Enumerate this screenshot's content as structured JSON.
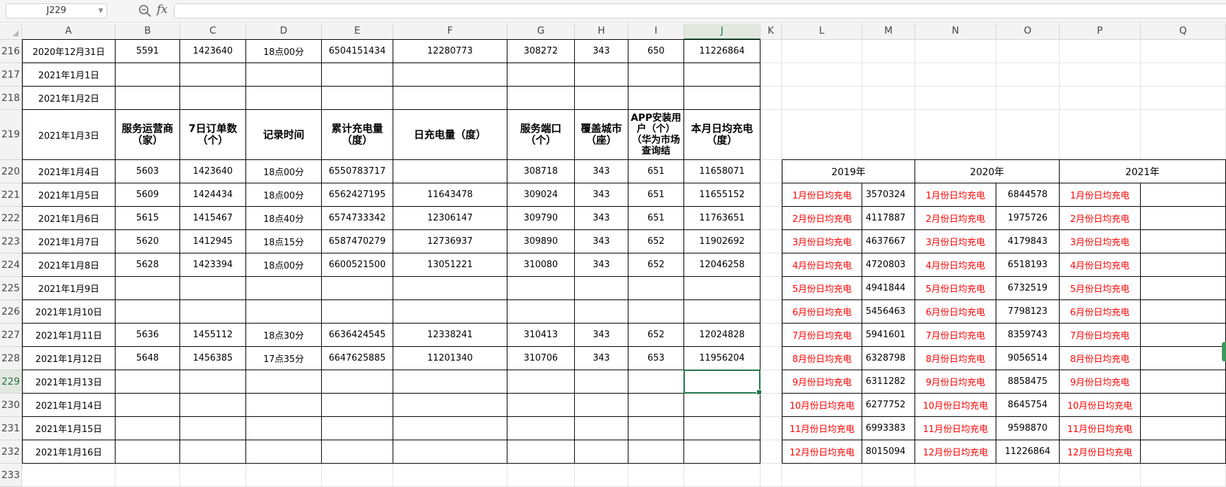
{
  "formula_bar": {
    "name_box": "J229",
    "fx_label": "fx",
    "formula_value": ""
  },
  "columns": [
    {
      "letter": "A",
      "w": 136
    },
    {
      "letter": "B",
      "w": 94
    },
    {
      "letter": "C",
      "w": 96
    },
    {
      "letter": "D",
      "w": 110
    },
    {
      "letter": "E",
      "w": 104
    },
    {
      "letter": "F",
      "w": 166
    },
    {
      "letter": "G",
      "w": 98
    },
    {
      "letter": "H",
      "w": 78
    },
    {
      "letter": "I",
      "w": 81
    },
    {
      "letter": "J",
      "w": 111
    },
    {
      "letter": "K",
      "w": 31
    },
    {
      "letter": "L",
      "w": 117
    },
    {
      "letter": "M",
      "w": 77
    },
    {
      "letter": "N",
      "w": 118
    },
    {
      "letter": "O",
      "w": 92
    },
    {
      "letter": "P",
      "w": 118
    },
    {
      "letter": "Q",
      "w": 124
    }
  ],
  "rows": [
    {
      "num": "216",
      "h": 34
    },
    {
      "num": "217",
      "h": 34
    },
    {
      "num": "218",
      "h": 34
    },
    {
      "num": "219",
      "h": 73
    },
    {
      "num": "220",
      "h": 34
    },
    {
      "num": "221",
      "h": 34
    },
    {
      "num": "222",
      "h": 34
    },
    {
      "num": "223",
      "h": 34
    },
    {
      "num": "224",
      "h": 34
    },
    {
      "num": "225",
      "h": 34
    },
    {
      "num": "226",
      "h": 34
    },
    {
      "num": "227",
      "h": 34
    },
    {
      "num": "228",
      "h": 34
    },
    {
      "num": "229",
      "h": 34
    },
    {
      "num": "230",
      "h": 34
    },
    {
      "num": "231",
      "h": 34
    },
    {
      "num": "232",
      "h": 34
    },
    {
      "num": "233",
      "h": 34
    }
  ],
  "main_headers": [
    "服务运营商（家）",
    "7日订单数（个）",
    "记录时间",
    "累计充电量（度）",
    "日充电量（度）",
    "服务端口（个）",
    "覆盖城市（座）",
    "APP安装用户（个）（华为市场查询结",
    "本月日均充电（度）"
  ],
  "main_table": [
    [
      "2020年12月31日",
      "5591",
      "1423640",
      "18点00分",
      "6504151434",
      "12280773",
      "308272",
      "343",
      "650",
      "11226864"
    ],
    [
      "2021年1月1日",
      "",
      "",
      "",
      "",
      "",
      "",
      "",
      "",
      ""
    ],
    [
      "2021年1月2日",
      "",
      "",
      "",
      "",
      "",
      "",
      "",
      "",
      ""
    ],
    [
      "2021年1月3日"
    ],
    [
      "2021年1月4日",
      "5603",
      "1423640",
      "18点00分",
      "6550783717",
      "",
      "308718",
      "343",
      "651",
      "11658071"
    ],
    [
      "2021年1月5日",
      "5609",
      "1424434",
      "18点00分",
      "6562427195",
      "11643478",
      "309024",
      "343",
      "651",
      "11655152"
    ],
    [
      "2021年1月6日",
      "5615",
      "1415467",
      "18点40分",
      "6574733342",
      "12306147",
      "309790",
      "343",
      "651",
      "11763651"
    ],
    [
      "2021年1月7日",
      "5620",
      "1412945",
      "18点15分",
      "6587470279",
      "12736937",
      "309890",
      "343",
      "652",
      "11902692"
    ],
    [
      "2021年1月8日",
      "5628",
      "1423394",
      "18点00分",
      "6600521500",
      "13051221",
      "310080",
      "343",
      "652",
      "12046258"
    ],
    [
      "2021年1月9日",
      "",
      "",
      "",
      "",
      "",
      "",
      "",
      "",
      ""
    ],
    [
      "2021年1月10日",
      "",
      "",
      "",
      "",
      "",
      "",
      "",
      "",
      ""
    ],
    [
      "2021年1月11日",
      "5636",
      "1455112",
      "18点30分",
      "6636424545",
      "12338241",
      "310413",
      "343",
      "652",
      "12024828"
    ],
    [
      "2021年1月12日",
      "5648",
      "1456385",
      "17点35分",
      "6647625885",
      "11201340",
      "310706",
      "343",
      "653",
      "11956204"
    ],
    [
      "2021年1月13日",
      "",
      "",
      "",
      "",
      "",
      "",
      "",
      "",
      ""
    ],
    [
      "2021年1月14日",
      "",
      "",
      "",
      "",
      "",
      "",
      "",
      "",
      ""
    ],
    [
      "2021年1月15日",
      "",
      "",
      "",
      "",
      "",
      "",
      "",
      "",
      ""
    ],
    [
      "2021年1月16日",
      "",
      "",
      "",
      "",
      "",
      "",
      "",
      "",
      ""
    ]
  ],
  "side_table": {
    "years": [
      "2019年",
      "2020年",
      "2021年"
    ],
    "rows": [
      [
        "1月份日均充电",
        "3570324",
        "1月份日均充电",
        "6844578",
        "1月份日均充电"
      ],
      [
        "2月份日均充电",
        "4117887",
        "2月份日均充电",
        "1975726",
        "2月份日均充电"
      ],
      [
        "3月份日均充电",
        "4637667",
        "3月份日均充电",
        "4179843",
        "3月份日均充电"
      ],
      [
        "4月份日均充电",
        "4720803",
        "4月份日均充电",
        "6518193",
        "4月份日均充电"
      ],
      [
        "5月份日均充电",
        "4941844",
        "5月份日均充电",
        "6732519",
        "5月份日均充电"
      ],
      [
        "6月份日均充电",
        "5456463",
        "6月份日均充电",
        "7798123",
        "6月份日均充电"
      ],
      [
        "7月份日均充电",
        "5941601",
        "7月份日均充电",
        "8359743",
        "7月份日均充电"
      ],
      [
        "8月份日均充电",
        "6328798",
        "8月份日均充电",
        "9056514",
        "8月份日均充电"
      ],
      [
        "9月份日均充电",
        "6311282",
        "9月份日均充电",
        "8858475",
        "9月份日均充电"
      ],
      [
        "10月份日均充电",
        "6277752",
        "10月份日均充电",
        "8645754",
        "10月份日均充电"
      ],
      [
        "11月份日均充电",
        "6993383",
        "11月份日均充电",
        "9598870",
        "11月份日均充电"
      ],
      [
        "12月份日均充电",
        "8015094",
        "12月份日均充电",
        "11226864",
        "12月份日均充电"
      ]
    ]
  },
  "selected_cell": {
    "col": "J",
    "row": "229"
  },
  "colors": {
    "selection": "#217346",
    "red_text": "#ff0000"
  }
}
